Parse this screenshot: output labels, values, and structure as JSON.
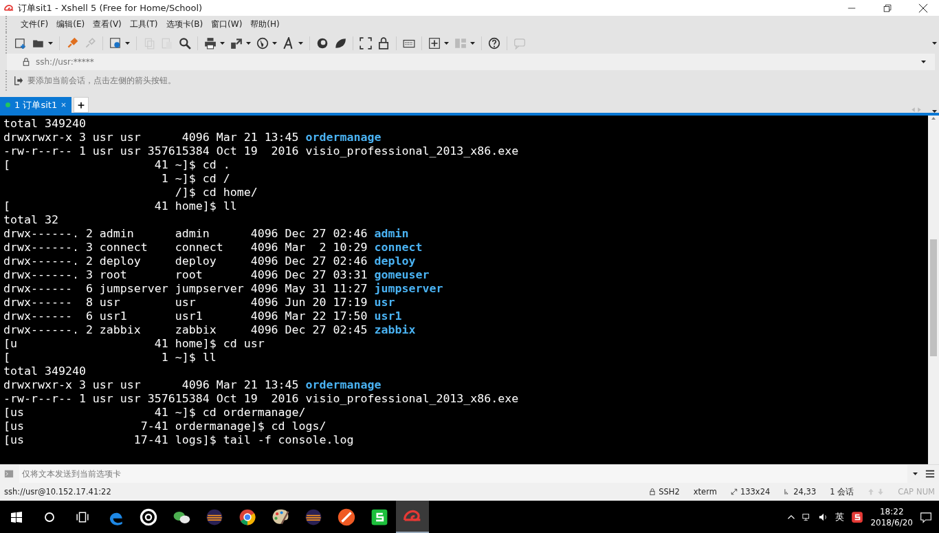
{
  "window": {
    "title": "订单sit1 - Xshell 5 (Free for Home/School)"
  },
  "menu": [
    "文件(F)",
    "编辑(E)",
    "查看(V)",
    "工具(T)",
    "选项卡(B)",
    "窗口(W)",
    "帮助(H)"
  ],
  "address_bar": {
    "value": "ssh://usr:*****"
  },
  "hint_bar": {
    "text": "要添加当前会话，点击左侧的箭头按钮。"
  },
  "tabs": [
    {
      "label": "1 订单sit1",
      "selected": true,
      "connected": true
    }
  ],
  "terminal": {
    "lines": [
      [
        {
          "text": "total 349240",
          "kind": "text"
        }
      ],
      [
        {
          "text": "drwxrwxr-x 3 usr usr      4096 Mar 21 13:45 ",
          "kind": "text"
        },
        {
          "text": "ordermanage",
          "kind": "dir"
        }
      ],
      [
        {
          "text": "-rw-r--r-- 1 usr usr 357615384 Oct 19  2016 visio_professional_2013_x86.exe",
          "kind": "text"
        }
      ],
      [
        {
          "text": "[                     41 ~]$ cd .",
          "kind": "text"
        }
      ],
      [
        {
          "text": "                       1 ~]$ cd /",
          "kind": "text"
        }
      ],
      [
        {
          "text": "                         /]$ cd home/",
          "kind": "text"
        }
      ],
      [
        {
          "text": "[                     41 home]$ ll",
          "kind": "text"
        }
      ],
      [
        {
          "text": "total 32",
          "kind": "text"
        }
      ],
      [
        {
          "text": "drwx------. 2 admin      admin      4096 Dec 27 02:46 ",
          "kind": "text"
        },
        {
          "text": "admin",
          "kind": "dir"
        }
      ],
      [
        {
          "text": "drwx------. 3 connect    connect    4096 Mar  2 10:29 ",
          "kind": "text"
        },
        {
          "text": "connect",
          "kind": "dir"
        }
      ],
      [
        {
          "text": "drwx------. 2 deploy     deploy     4096 Dec 27 02:46 ",
          "kind": "text"
        },
        {
          "text": "deploy",
          "kind": "dir"
        }
      ],
      [
        {
          "text": "drwx------. 3 root       root       4096 Dec 27 03:31 ",
          "kind": "text"
        },
        {
          "text": "gomeuser",
          "kind": "dir"
        }
      ],
      [
        {
          "text": "drwx------  6 jumpserver jumpserver 4096 May 31 11:27 ",
          "kind": "text"
        },
        {
          "text": "jumpserver",
          "kind": "dir"
        }
      ],
      [
        {
          "text": "drwx------  8 usr        usr        4096 Jun 20 17:19 ",
          "kind": "text"
        },
        {
          "text": "usr",
          "kind": "dir"
        }
      ],
      [
        {
          "text": "drwx------  6 usr1       usr1       4096 Mar 22 17:50 ",
          "kind": "text"
        },
        {
          "text": "usr1",
          "kind": "dir"
        }
      ],
      [
        {
          "text": "drwx------. 2 zabbix     zabbix     4096 Dec 27 02:45 ",
          "kind": "text"
        },
        {
          "text": "zabbix",
          "kind": "dir"
        }
      ],
      [
        {
          "text": "[u                    41 home]$ cd usr",
          "kind": "text"
        }
      ],
      [
        {
          "text": "[                      1 ~]$ ll",
          "kind": "text"
        }
      ],
      [
        {
          "text": "total 349240",
          "kind": "text"
        }
      ],
      [
        {
          "text": "drwxrwxr-x 3 usr usr      4096 Mar 21 13:45 ",
          "kind": "text"
        },
        {
          "text": "ordermanage",
          "kind": "dir"
        }
      ],
      [
        {
          "text": "-rw-r--r-- 1 usr usr 357615384 Oct 19  2016 visio_professional_2013_x86.exe",
          "kind": "text"
        }
      ],
      [
        {
          "text": "[us                   41 ~]$ cd ordermanage/",
          "kind": "text"
        }
      ],
      [
        {
          "text": "[us                 7-41 ordermanage]$ cd logs/",
          "kind": "text"
        }
      ],
      [
        {
          "text": "[us                17-41 logs]$ tail -f console.log",
          "kind": "text"
        }
      ]
    ]
  },
  "compose_bar": {
    "placeholder": "仅将文本发送到当前选项卡"
  },
  "status_bar": {
    "connection": "ssh://usr@10.152.17.41:22",
    "items": [
      {
        "text": "SSH2",
        "kind": "lock"
      },
      {
        "text": "xterm",
        "kind": "plain"
      },
      {
        "text": "133x24",
        "kind": "size"
      },
      {
        "text": "24,33",
        "kind": "cursor"
      },
      {
        "text": "1 会话",
        "kind": "plain"
      }
    ],
    "indicators": [
      {
        "text": "CAP",
        "on": false
      },
      {
        "text": "NUM",
        "on": false
      }
    ]
  },
  "taskbar": {
    "apps": [
      {
        "kind": "edge",
        "selected": false
      },
      {
        "kind": "target",
        "selected": false
      },
      {
        "kind": "chat",
        "selected": false
      },
      {
        "kind": "eclipse",
        "selected": false
      },
      {
        "kind": "chrome",
        "selected": false
      },
      {
        "kind": "paint",
        "selected": false
      },
      {
        "kind": "eclipse",
        "selected": false
      },
      {
        "kind": "pen",
        "selected": false
      },
      {
        "kind": "green",
        "selected": false
      },
      {
        "kind": "shell",
        "selected": true
      }
    ],
    "ime": "英",
    "time": "18:22",
    "date": "2018/6/20"
  }
}
